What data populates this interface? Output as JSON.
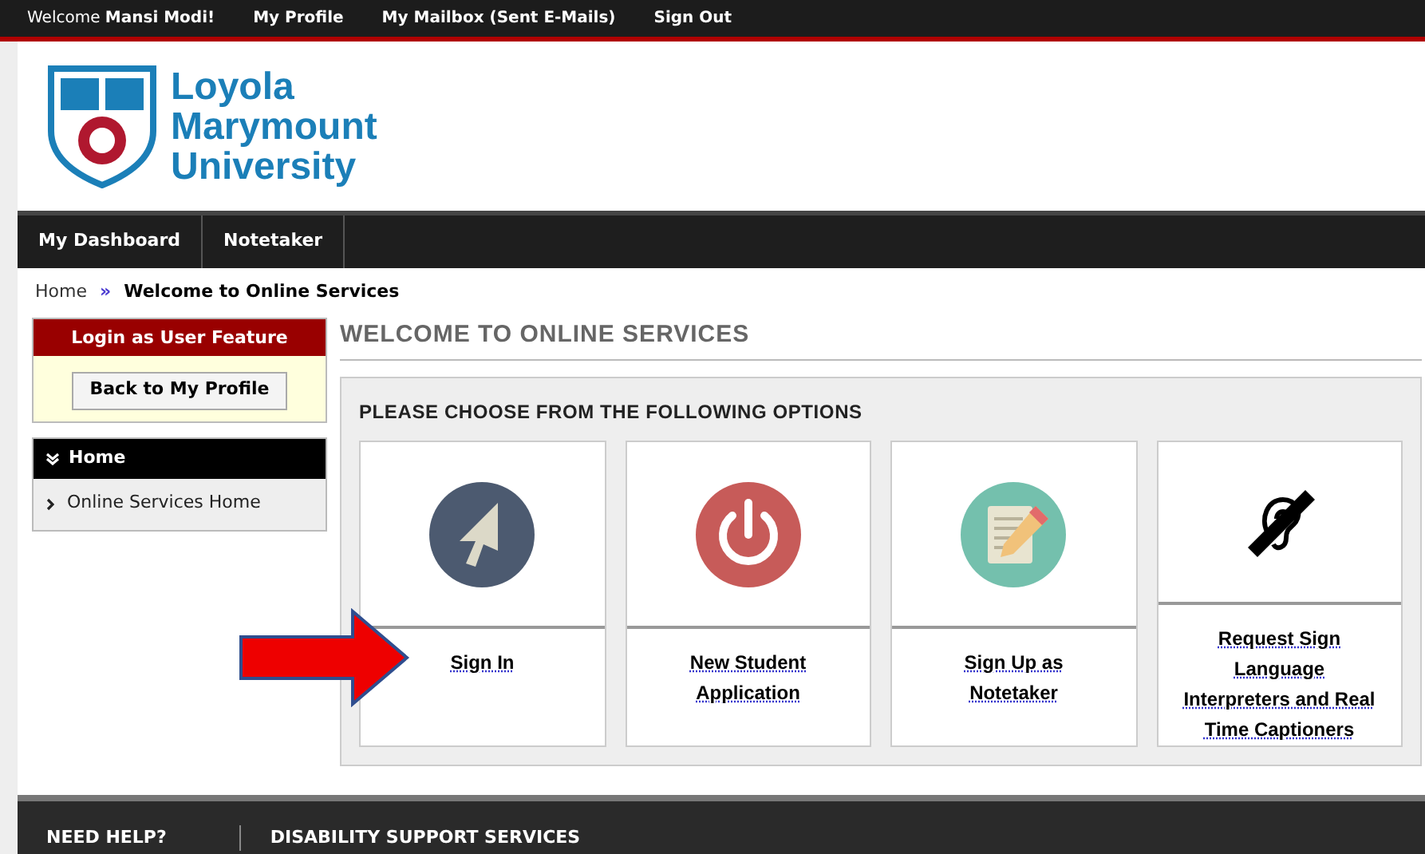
{
  "top_bar": {
    "welcome": "Welcome **Mansi Modi!**",
    "links": [
      "My Profile",
      "My Mailbox (Sent E-Mails)",
      "Sign Out"
    ]
  },
  "logo": {
    "lines": [
      "Loyola",
      "Marymount",
      "University"
    ]
  },
  "nav": {
    "items": [
      {
        "label": "My Dashboard",
        "selected": false
      },
      {
        "label": "Notetaker",
        "selected": false
      }
    ]
  },
  "breadcrumb": {
    "items": [
      "Home",
      "Welcome to Online Services"
    ],
    "separator": "»"
  },
  "sidebar": {
    "login_panel": {
      "title": "Login as User Feature",
      "button": "Back to My Profile"
    },
    "menu": {
      "title": "Home",
      "expanded": true,
      "items": [
        "Online Services Home"
      ]
    }
  },
  "main": {
    "heading": "WELCOME TO ONLINE SERVICES",
    "subheading": "PLEASE CHOOSE FROM THE FOLLOWING OPTIONS",
    "options": [
      {
        "kind": "cursor",
        "label": "Sign In"
      },
      {
        "kind": "power",
        "label": "New Student Application"
      },
      {
        "kind": "notepad",
        "label": "Sign Up as Notetaker"
      },
      {
        "kind": "hearing",
        "label": "Request Sign Language Interpreters and Real Time Captioners"
      }
    ],
    "annotation": {
      "kind": "arrow"
    }
  },
  "footer": {
    "columns": [
      "NEED HELP?",
      "DISABILITY SUPPORT SERVICES"
    ]
  }
}
